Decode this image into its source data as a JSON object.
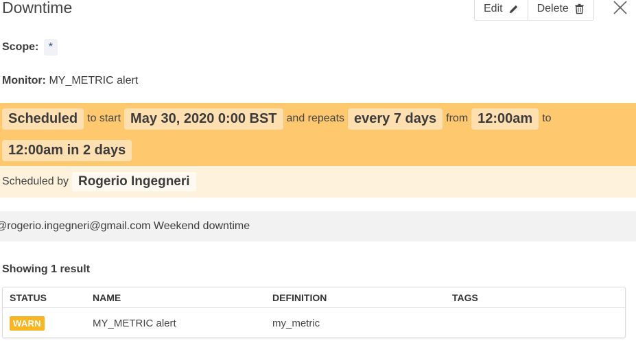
{
  "header": {
    "title": "Downtime",
    "edit_label": "Edit",
    "delete_label": "Delete"
  },
  "scope": {
    "label": "Scope:",
    "value": "*"
  },
  "monitor": {
    "label": "Monitor:",
    "value": "MY_METRIC alert"
  },
  "schedule": {
    "status": "Scheduled",
    "to_start_text": "to start",
    "start_date": "May 30, 2020 0:00 BST",
    "repeats_text": "and repeats",
    "repeat_interval": "every 7 days",
    "from_text": "from",
    "from_time": "12:00am",
    "to_text": "to",
    "to_time": "12:00am in 2 days"
  },
  "scheduled_by": {
    "label": "Scheduled by",
    "user": "Rogerio Ingegneri"
  },
  "message": "@rogerio.ingegneri@gmail.com Weekend downtime",
  "results": {
    "summary": "Showing 1 result",
    "columns": [
      "STATUS",
      "NAME",
      "DEFINITION",
      "TAGS"
    ],
    "rows": [
      {
        "status": "WARN",
        "name": "MY_METRIC alert",
        "definition": "my_metric",
        "tags": ""
      }
    ]
  },
  "colors": {
    "schedule_bg": "#fec86f",
    "schedule_chip": "#fee0b0",
    "scheduled_by_bg": "#fff2dc",
    "warn_badge": "#f9b522"
  }
}
